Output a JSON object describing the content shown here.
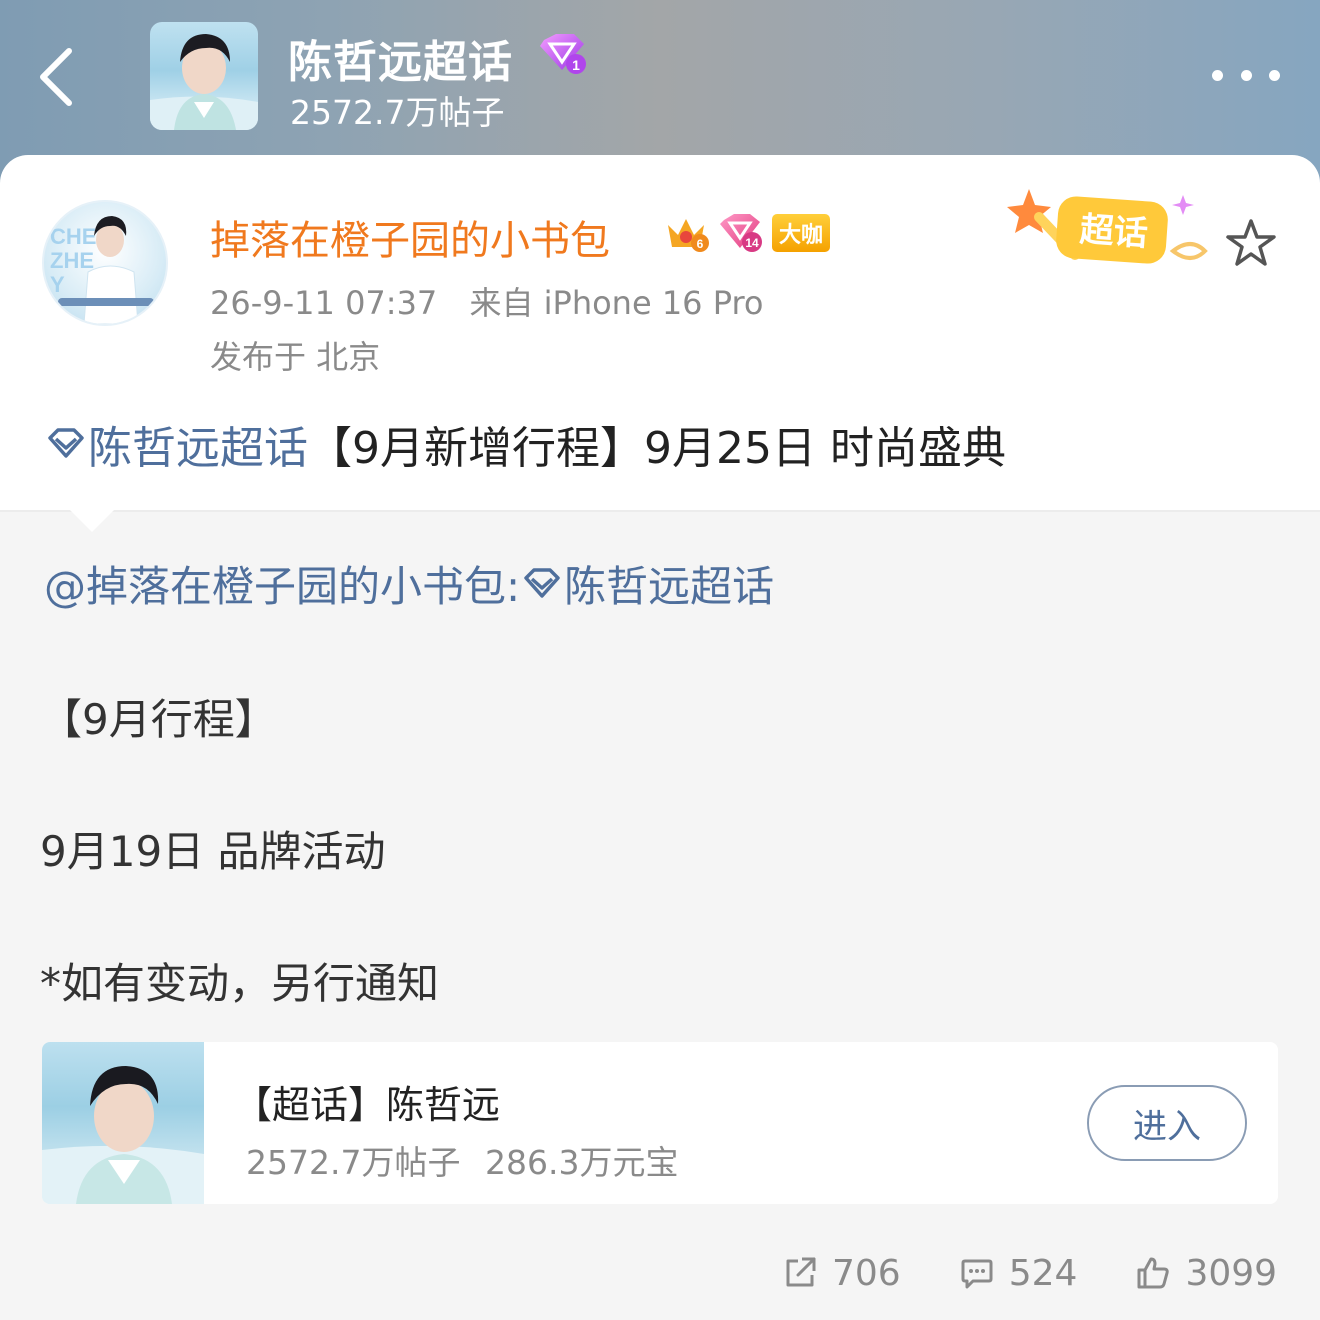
{
  "header": {
    "topic_title": "陈哲远超话",
    "topic_level": "1",
    "post_count": "2572.7万帖子",
    "icons": [
      "back-arrow-icon",
      "more-dots-icon",
      "diamond-level-icon"
    ]
  },
  "post": {
    "username": "掉落在橙子园的小书包",
    "crown_level": "6",
    "diamond_level": "14",
    "badge_label": "大咖",
    "date": "26-9-11 07:37",
    "source": "来自 iPhone 16 Pro",
    "location": "发布于 北京",
    "sticker_text": "超话",
    "topic_link": "陈哲远超话",
    "text": "【9月新增行程】9月25日 时尚盛典"
  },
  "quoted": {
    "mention": "@掉落在橙子园的小书包:",
    "topic_link": "陈哲远超话",
    "lines": [
      "【9月行程】",
      "9月19日 品牌活动",
      "*如有变动，另行通知"
    ]
  },
  "topic_card": {
    "title": "【超话】陈哲远",
    "posts": "2572.7万帖子",
    "coins": "286.3万元宝",
    "enter_label": "进入"
  },
  "actions": {
    "share_count": "706",
    "comment_count": "524",
    "like_count": "3099"
  },
  "colors": {
    "username": "#f0791e",
    "link": "#4f6f9c",
    "meta": "#8a8a8a",
    "badge": "#f5a100",
    "diamond": "#c04cf0"
  }
}
